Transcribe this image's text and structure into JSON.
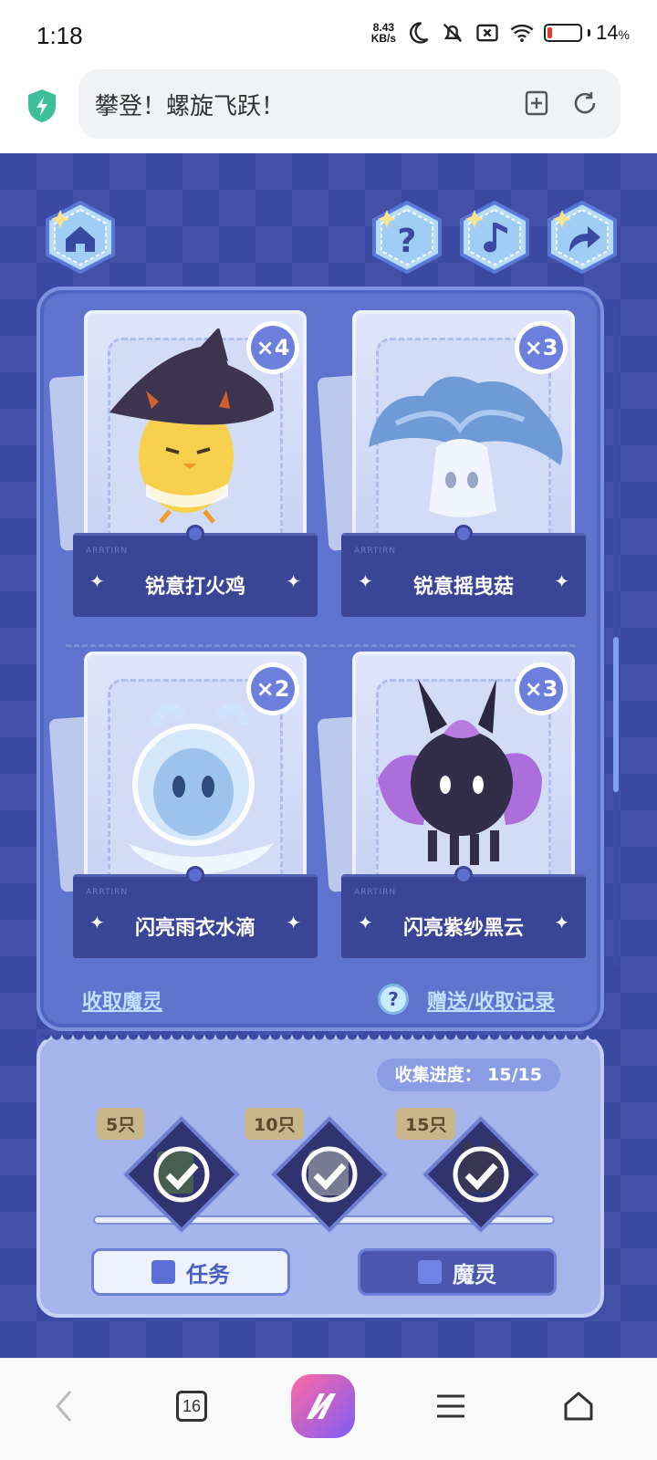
{
  "status_bar": {
    "time": "1:18",
    "net_speed_value": "8.43",
    "net_speed_unit": "KB/s",
    "battery_percent": "14",
    "battery_symbol": "%",
    "battery_level": 0.14,
    "icons": [
      "moon-icon",
      "mute-icon",
      "close-box-icon",
      "wifi-icon",
      "battery-icon"
    ]
  },
  "browser": {
    "title": "攀登！螺旋飞跃！",
    "tab_count": "16",
    "icons": [
      "shield-icon",
      "add-bookmark-icon",
      "reload-icon",
      "back-icon",
      "menu-icon",
      "home-icon"
    ]
  },
  "game": {
    "top_buttons": [
      "home-icon",
      "help-icon",
      "music-icon",
      "share-icon"
    ],
    "cards": [
      {
        "name": "锐意打火鸡",
        "count": "×4"
      },
      {
        "name": "锐意摇曳菇",
        "count": "×3"
      },
      {
        "name": "闪亮雨衣水滴",
        "count": "×2"
      },
      {
        "name": "闪亮紫纱黑云",
        "count": "×3"
      }
    ],
    "card_small_text": "ARRTIRN",
    "links": {
      "collect": "收取魔灵",
      "help_mark": "?",
      "records": "赠送/收取记录"
    },
    "collect_progress": "收集进度： 15/15",
    "rewards": [
      {
        "tag": "5只",
        "claimed": true
      },
      {
        "tag": "10只",
        "claimed": true
      },
      {
        "tag": "15只",
        "claimed": true
      }
    ],
    "buttons": {
      "task": "任务",
      "spirit": "魔灵"
    },
    "colors": {
      "background": "#3a4aa3",
      "panel": "#5e74cf",
      "label_plate": "#3a4595",
      "badge": "#6d7fdd"
    }
  }
}
